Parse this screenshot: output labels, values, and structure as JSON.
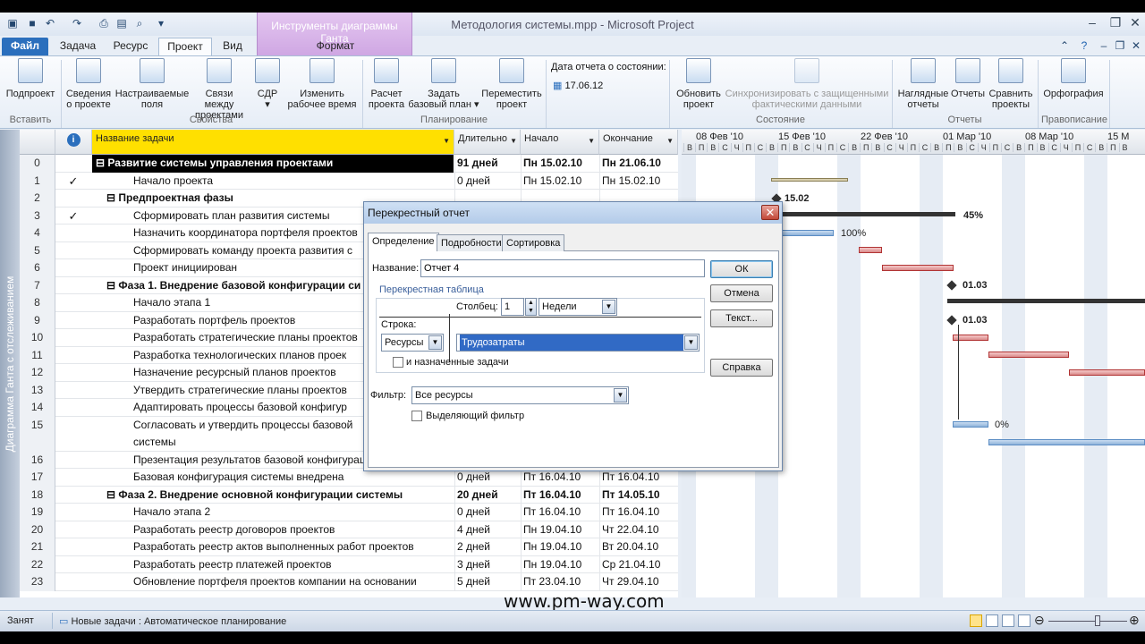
{
  "title": "Методология системы.mpp - Microsoft Project",
  "gantt_tools": {
    "title": "Инструменты диаграммы Ганта",
    "tab": "Формат"
  },
  "tabs": [
    {
      "label": "Файл"
    },
    {
      "label": "Задача"
    },
    {
      "label": "Ресурс"
    },
    {
      "label": "Проект"
    },
    {
      "label": "Вид"
    }
  ],
  "ribbon": {
    "buttons": [
      {
        "label1": "Подпроект",
        "label2": ""
      },
      {
        "label1": "Сведения",
        "label2": "о проекте"
      },
      {
        "label1": "Настраиваемые",
        "label2": "поля"
      },
      {
        "label1": "Связи между",
        "label2": "проектами"
      },
      {
        "label1": "СДР",
        "label2": "▾"
      },
      {
        "label1": "Изменить",
        "label2": "рабочее время"
      },
      {
        "label1": "Расчет",
        "label2": "проекта"
      },
      {
        "label1": "Задать",
        "label2": "базовый план ▾"
      },
      {
        "label1": "Переместить",
        "label2": "проект"
      },
      {
        "label1": "Обновить",
        "label2": "проект"
      },
      {
        "label1": "Синхронизировать с защищенными",
        "label2": "фактическими данными"
      },
      {
        "label1": "Наглядные",
        "label2": "отчеты"
      },
      {
        "label1": "Отчеты",
        "label2": ""
      },
      {
        "label1": "Сравнить",
        "label2": "проекты"
      },
      {
        "label1": "Орфография",
        "label2": ""
      }
    ],
    "status_date_label": "Дата отчета о состоянии:",
    "status_date_value": "17.06.12",
    "groups": [
      "Вставить",
      "Свойства",
      "Планирование",
      "Состояние",
      "Отчеты",
      "Правописание"
    ]
  },
  "side_label": "Диаграмма Ганта с отслеживанием",
  "table": {
    "headers": [
      "Название задачи",
      "Длительно",
      "Начало",
      "Окончание"
    ],
    "rows": [
      {
        "id": "0",
        "mark": "",
        "name": "⊟ Развитие системы управления проектами",
        "dur": "91 дней",
        "start": "Пн 15.02.10",
        "end": "Пн 21.06.10"
      },
      {
        "id": "1",
        "mark": "✓",
        "name": "Начало проекта",
        "dur": "0 дней",
        "start": "Пн 15.02.10",
        "end": "Пн 15.02.10"
      },
      {
        "id": "2",
        "mark": "",
        "name": "⊟ Предпроектная фазы",
        "dur": "",
        "start": "",
        "end": ""
      },
      {
        "id": "3",
        "mark": "✓",
        "name": "Сформировать план развития системы",
        "dur": "",
        "start": "",
        "end": ""
      },
      {
        "id": "4",
        "mark": "",
        "name": "Назначить координатора портфеля проектов",
        "dur": "",
        "start": "",
        "end": ""
      },
      {
        "id": "5",
        "mark": "",
        "name": "Сформировать команду проекта развития с",
        "dur": "",
        "start": "",
        "end": ""
      },
      {
        "id": "6",
        "mark": "",
        "name": "Проект инициирован",
        "dur": "",
        "start": "",
        "end": ""
      },
      {
        "id": "7",
        "mark": "",
        "name": "⊟ Фаза 1. Внедрение базовой конфигурации си",
        "dur": "",
        "start": "",
        "end": ""
      },
      {
        "id": "8",
        "mark": "",
        "name": "Начало этапа 1",
        "dur": "",
        "start": "",
        "end": ""
      },
      {
        "id": "9",
        "mark": "",
        "name": "Разработать портфель проектов",
        "dur": "",
        "start": "",
        "end": ""
      },
      {
        "id": "10",
        "mark": "",
        "name": "Разработать стратегические планы проектов",
        "dur": "",
        "start": "",
        "end": ""
      },
      {
        "id": "11",
        "mark": "",
        "name": "Разработка технологических планов проек",
        "dur": "",
        "start": "",
        "end": ""
      },
      {
        "id": "12",
        "mark": "",
        "name": "Назначение ресурсный планов проектов",
        "dur": "",
        "start": "",
        "end": ""
      },
      {
        "id": "13",
        "mark": "",
        "name": "Утвердить стратегические планы проектов",
        "dur": "",
        "start": "",
        "end": ""
      },
      {
        "id": "14",
        "mark": "",
        "name": "Адаптировать процессы базовой конфигур",
        "dur": "",
        "start": "",
        "end": ""
      },
      {
        "id": "15",
        "mark": "",
        "name": "Согласовать и утвердить процессы базовой",
        "name2": "системы",
        "dur": "",
        "start": "",
        "end": ""
      },
      {
        "id": "16",
        "mark": "",
        "name": "Презентация результатов базовой конфигурации системы",
        "dur": "1 день",
        "start": "Пт 16.04.10",
        "end": "Пт 16.04.10"
      },
      {
        "id": "17",
        "mark": "",
        "name": "Базовая конфигурация системы внедрена",
        "dur": "0 дней",
        "start": "Пт 16.04.10",
        "end": "Пт 16.04.10"
      },
      {
        "id": "18",
        "mark": "",
        "name": "⊟ Фаза 2. Внедрение основной конфигурации системы",
        "dur": "20 дней",
        "start": "Пт 16.04.10",
        "end": "Пт 14.05.10"
      },
      {
        "id": "19",
        "mark": "",
        "name": "Начало этапа 2",
        "dur": "0 дней",
        "start": "Пт 16.04.10",
        "end": "Пт 16.04.10"
      },
      {
        "id": "20",
        "mark": "",
        "name": "Разработать реестр договоров проектов",
        "dur": "4 дней",
        "start": "Пн 19.04.10",
        "end": "Чт 22.04.10"
      },
      {
        "id": "21",
        "mark": "",
        "name": "Разработать реестр актов выполненных работ проектов",
        "dur": "2 дней",
        "start": "Пн 19.04.10",
        "end": "Вт 20.04.10"
      },
      {
        "id": "22",
        "mark": "",
        "name": "Разработать реестр платежей проектов",
        "dur": "3 дней",
        "start": "Пн 19.04.10",
        "end": "Ср 21.04.10"
      },
      {
        "id": "23",
        "mark": "",
        "name": "Обновление портфеля проектов компании на основании",
        "dur": "5 дней",
        "start": "Пт 23.04.10",
        "end": "Чт 29.04.10"
      }
    ]
  },
  "gantt": {
    "weeks": [
      "08 Фев '10",
      "15 Фев '10",
      "22 Фев '10",
      "01 Мар '10",
      "08 Мар '10",
      "15 М"
    ],
    "days": [
      "В",
      "П",
      "В",
      "С",
      "Ч",
      "П",
      "С",
      "В",
      "П",
      "В",
      "С",
      "Ч",
      "П",
      "С",
      "В",
      "П",
      "В",
      "С",
      "Ч",
      "П",
      "С",
      "В",
      "П",
      "В",
      "С",
      "Ч",
      "П",
      "С",
      "В",
      "П",
      "В",
      "С",
      "Ч",
      "П",
      "С",
      "В",
      "П",
      "В"
    ],
    "labels": [
      "15.02",
      "45%",
      "100%",
      "01.03",
      "01.03",
      "0%"
    ]
  },
  "dialog": {
    "title": "Перекрестный отчет",
    "tabs": [
      "Определение",
      "Подробности",
      "Сортировка"
    ],
    "name_label": "Название:",
    "name_value": "Отчет 4",
    "crosstab_label": "Перекрестная таблица",
    "column_label": "Столбец:",
    "column_count": "1",
    "column_unit": "Недели",
    "row_label": "Строка:",
    "row_value": "Ресурсы",
    "field_value": "Трудозатраты",
    "assigned_label": "и назначенные задачи",
    "filter_label": "Фильтр:",
    "filter_value": "Все ресурсы",
    "highlight_label": "Выделяющий фильтр",
    "buttons": {
      "ok": "ОК",
      "cancel": "Отмена",
      "text": "Текст...",
      "help": "Справка"
    }
  },
  "status": {
    "state": "Занят",
    "new_tasks": "Новые задачи : Автоматическое планирование"
  },
  "watermark": "www.pm-way.com"
}
